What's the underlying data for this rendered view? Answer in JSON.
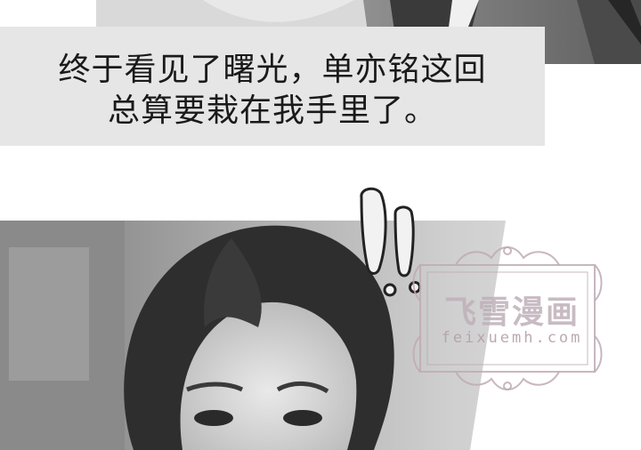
{
  "caption": {
    "line1": "终于看见了曙光，单亦铭这回",
    "line2": "总算要栽在我手里了。"
  },
  "watermark": {
    "name": "飞雪漫画",
    "site": "feixuemh.com"
  },
  "sfx": {
    "exclamation": "!!"
  },
  "colors": {
    "caption_bg": "#e6e6e6",
    "watermark": "#c8b8c0"
  }
}
